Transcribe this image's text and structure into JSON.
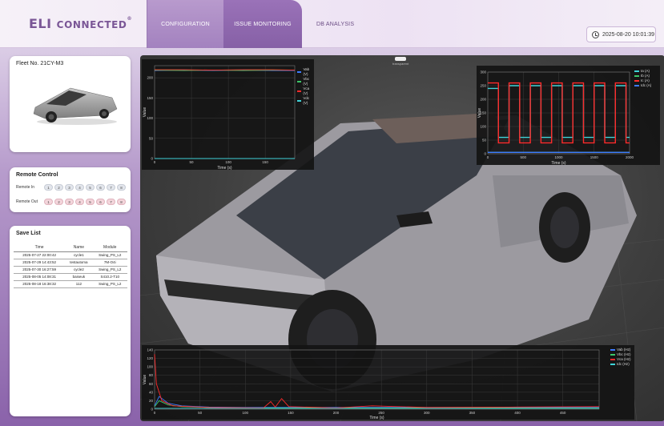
{
  "header": {
    "logo_a": "ELI",
    "logo_b": "CONNECTED",
    "logo_reg": "®",
    "tabs": [
      {
        "label": "CONFIGURATION"
      },
      {
        "label": "ISSUE MONITORING"
      },
      {
        "label": "DB ANALYSIS"
      }
    ],
    "datetime": "2025-08-20 10:01:39"
  },
  "fleet": {
    "title": "Fleet No. 21CY-M3"
  },
  "remote": {
    "title": "Remote Control",
    "in_label": "Remote In",
    "out_label": "Remote Out",
    "buttons": [
      "1",
      "2",
      "3",
      "4",
      "5",
      "6",
      "7",
      "8"
    ]
  },
  "save_list": {
    "title": "Save List",
    "columns": [
      "Time",
      "Name",
      "Module"
    ],
    "rows": [
      [
        "2025-07-27 22:00:42",
        "cycle1",
        "Swing_PS_L2"
      ],
      [
        "2025-07-29 14:43:52",
        "testautoma",
        "7M-O4i"
      ],
      [
        "2025-07-30 16:27:59",
        "cycle2",
        "Swing_PS_L2"
      ],
      [
        "2025-08-05 14:08:31",
        "baiseuk",
        "S410.2-T10"
      ],
      [
        "2025-08-18 16:38:32",
        "112",
        "Swing_PS_L2"
      ]
    ]
  },
  "viewport": {
    "badge_label": "transparent"
  },
  "colors": {
    "accent": "#7a5696",
    "series_blue": "#3d7bff",
    "series_green": "#3cc86a",
    "series_red": "#ff2b2b",
    "series_cyan": "#3fd3d8"
  },
  "chart_data": [
    {
      "type": "line",
      "title": "",
      "xlabel": "Time (s)",
      "ylabel": "Value",
      "xlim": [
        0,
        190
      ],
      "ylim": [
        0,
        230
      ],
      "xticks": [
        "0",
        "50",
        "100",
        "150"
      ],
      "yticks": [
        "0",
        "50",
        "100",
        "150",
        "200"
      ],
      "legend": "top-right",
      "series": [
        {
          "name": "Vab (V)",
          "color": "#3d7bff",
          "x": [
            0,
            40,
            80,
            120,
            160,
            190
          ],
          "values": [
            218,
            219,
            218,
            219,
            218,
            218
          ]
        },
        {
          "name": "Vbc (V)",
          "color": "#3cc86a",
          "x": [
            0,
            40,
            80,
            120,
            160,
            190
          ],
          "values": [
            219,
            218,
            219,
            218,
            219,
            219
          ]
        },
        {
          "name": "Vca (V)",
          "color": "#ff2b2b",
          "x": [
            0,
            40,
            80,
            120,
            160,
            190
          ],
          "values": [
            220,
            220,
            219,
            220,
            220,
            219
          ]
        },
        {
          "name": "Vdc (V)",
          "color": "#3fd3d8",
          "x": [
            0,
            190
          ],
          "values": [
            0,
            0
          ]
        }
      ]
    },
    {
      "type": "line",
      "title": "",
      "xlabel": "Time (s)",
      "ylabel": "Value",
      "xlim": [
        0,
        2000
      ],
      "ylim": [
        0,
        300
      ],
      "xticks": [
        "0",
        "500",
        "1000",
        "1500",
        "2000"
      ],
      "yticks": [
        "0",
        "50",
        "100",
        "150",
        "200",
        "250",
        "300"
      ],
      "legend": "top-right",
      "series": [
        {
          "name": "Ia (A)",
          "color": "#3fd3d8",
          "x": [
            0,
            150,
            300,
            450,
            600,
            750,
            900,
            1050,
            1200,
            1350,
            1500,
            1650,
            1800,
            1950
          ],
          "values": [
            240,
            60,
            250,
            60,
            250,
            60,
            250,
            60,
            250,
            60,
            250,
            60,
            250,
            60
          ]
        },
        {
          "name": "Ib (A)",
          "color": "#3cc86a",
          "x": [
            0,
            2000
          ],
          "values": [
            5,
            5
          ]
        },
        {
          "name": "Ic (A)",
          "color": "#ff2b2b",
          "x": [
            0,
            150,
            300,
            450,
            600,
            750,
            900,
            1050,
            1200,
            1350,
            1500,
            1650,
            1800,
            1950
          ],
          "values": [
            260,
            40,
            260,
            40,
            260,
            40,
            260,
            40,
            260,
            40,
            260,
            40,
            260,
            40
          ]
        },
        {
          "name": "Idc (A)",
          "color": "#3d7bff",
          "x": [
            0,
            2000
          ],
          "values": [
            5,
            5
          ]
        }
      ]
    },
    {
      "type": "line",
      "title": "",
      "xlabel": "Time (s)",
      "ylabel": "Value",
      "xlim": [
        0,
        490
      ],
      "ylim": [
        0,
        140
      ],
      "xticks": [
        "0",
        "50",
        "100",
        "150",
        "200",
        "250",
        "300",
        "350",
        "400",
        "450"
      ],
      "yticks": [
        "0",
        "20",
        "40",
        "60",
        "80",
        "100",
        "120",
        "140"
      ],
      "legend": "top-right",
      "series": [
        {
          "name": "Vab (Hz)",
          "color": "#3d7bff",
          "x": [
            0,
            5,
            15,
            30,
            60,
            100,
            200,
            300,
            400,
            490
          ],
          "values": [
            8,
            30,
            14,
            8,
            5,
            4,
            4,
            4,
            4,
            4
          ]
        },
        {
          "name": "Vbc (Hz)",
          "color": "#3cc86a",
          "x": [
            0,
            5,
            15,
            30,
            60,
            100,
            200,
            300,
            400,
            490
          ],
          "values": [
            6,
            20,
            10,
            6,
            4,
            3,
            3,
            3,
            3,
            3
          ]
        },
        {
          "name": "Vca (Hz)",
          "color": "#ff2b2b",
          "x": [
            0,
            2,
            8,
            20,
            60,
            120,
            128,
            133,
            140,
            148,
            200,
            240,
            300,
            400,
            490
          ],
          "values": [
            130,
            60,
            20,
            8,
            4,
            3,
            18,
            5,
            25,
            6,
            3,
            8,
            4,
            5,
            6
          ]
        },
        {
          "name": "Idc (Hz)",
          "color": "#3fd3d8",
          "x": [
            0,
            490
          ],
          "values": [
            2,
            2
          ]
        }
      ]
    }
  ]
}
